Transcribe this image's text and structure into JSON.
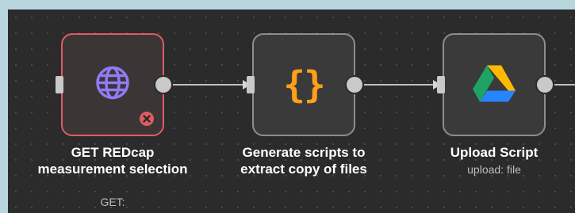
{
  "workflow": {
    "nodes": [
      {
        "id": "get-redcap",
        "type": "http-request",
        "status": "error",
        "icon": "globe-icon",
        "title_line1": "GET REDcap",
        "title_line2": "measurement selection",
        "subtitle": "GET:"
      },
      {
        "id": "generate-scripts",
        "type": "code",
        "status": "ok",
        "icon": "code-braces-icon",
        "icon_glyph": "{}",
        "title_line1": "Generate scripts to",
        "title_line2": "extract copy of files",
        "subtitle": ""
      },
      {
        "id": "upload-script",
        "type": "google-drive",
        "status": "ok",
        "icon": "google-drive-icon",
        "title_line1": "Upload Script",
        "title_line2": "",
        "subtitle": "upload: file"
      }
    ],
    "colors": {
      "canvas": "#2b2b2b",
      "node_bg": "#3a3a3a",
      "error_border": "#e05b62",
      "error_badge": "#e05b62",
      "globe": "#8f7cf3",
      "code": "#ff9f1a",
      "drive_green": "#1ea362",
      "drive_yellow": "#ffba00",
      "drive_blue": "#2684fc"
    }
  }
}
